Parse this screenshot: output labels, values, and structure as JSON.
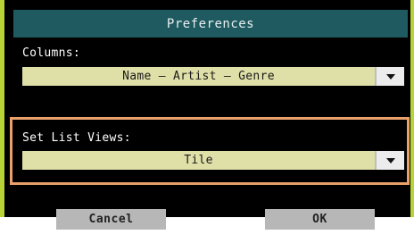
{
  "dialog": {
    "title": "Preferences"
  },
  "columns": {
    "label": "Columns:",
    "value": "Name – Artist – Genre",
    "dropdown_icon": "chevron-down-icon"
  },
  "set_list_views": {
    "label": "Set List Views:",
    "value": "Tile",
    "dropdown_icon": "chevron-down-icon"
  },
  "buttons": {
    "cancel_label": "Cancel",
    "ok_label": "OK"
  },
  "colors": {
    "frame": "#b7d336",
    "title_bar": "#1e5a5f",
    "select_bg": "#dfe0a8",
    "highlight": "#e9a06a",
    "button_bg": "#b7b7b7"
  }
}
